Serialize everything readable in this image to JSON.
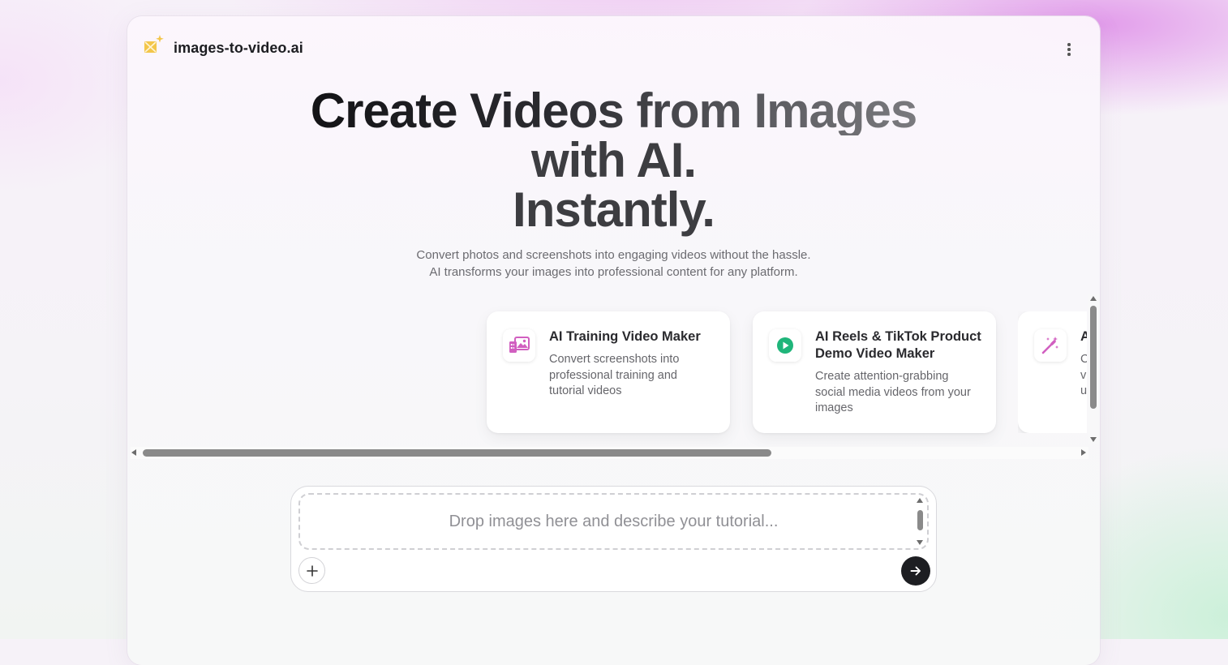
{
  "app": {
    "brand": "images-to-video.ai",
    "logo_icon": "sparkle-image-icon",
    "menu_icon": "more-vertical-icon"
  },
  "hero": {
    "title_line1": "Create Videos from Images",
    "title_line2": "with AI.",
    "title_line3": "Instantly.",
    "subtitle_line1": "Convert photos and screenshots into engaging videos without the hassle.",
    "subtitle_line2": "AI transforms your images into professional content for any platform."
  },
  "cards": [
    {
      "icon": "training-video-icon",
      "title": "AI Training Video Maker",
      "description": "Convert screenshots into professional training and tutorial videos"
    },
    {
      "icon": "play-circle-icon",
      "title": "AI Reels & TikTok Product Demo Video Maker",
      "description": "Create attention-grabbing social media videos from your images"
    },
    {
      "icon": "magic-wand-icon",
      "title": "A",
      "description": "C v u"
    }
  ],
  "composer": {
    "placeholder": "Drop images here and describe your tutorial...",
    "add_icon": "plus-icon",
    "send_icon": "arrow-right-icon"
  },
  "colors": {
    "pink_accent": "#d15fc0",
    "green_accent": "#1fb57a",
    "dark": "#1d1e22",
    "logo_yellow": "#f3c64a"
  }
}
